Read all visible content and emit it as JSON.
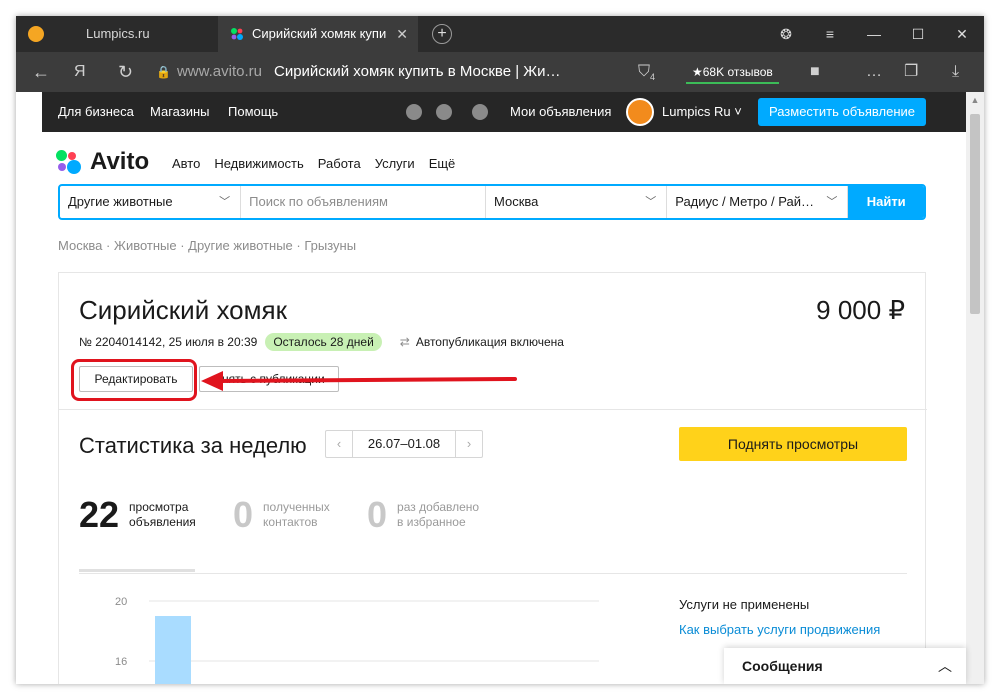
{
  "browser": {
    "tabs": [
      {
        "label": "Lumpics.ru"
      },
      {
        "label": "Сирийский хомяк купи"
      }
    ],
    "url_host": "www.avito.ru",
    "url_title": "Сирийский хомяк купить в Москве | Жи…",
    "protect_count": "4",
    "reviews": "★68K отзывов",
    "window_controls": {
      "menu": "≡",
      "minimize": "—",
      "maximize": "☐",
      "close": "✕"
    }
  },
  "topnav": {
    "business": "Для бизнеса",
    "shops": "Магазины",
    "help": "Помощь",
    "my_ads": "Мои объявления",
    "user": "Lumpics Ru",
    "post_button": "Разместить объявление"
  },
  "header": {
    "brand": "Avito",
    "categories": [
      "Авто",
      "Недвижимость",
      "Работа",
      "Услуги",
      "Ещё"
    ]
  },
  "search": {
    "category": "Другие животные",
    "placeholder": "Поиск по объявлениям",
    "city": "Москва",
    "radius": "Радиус / Метро / Рай…",
    "button": "Найти"
  },
  "breadcrumbs": "Москва · Животные · Другие животные · Грызуны",
  "ad": {
    "title": "Сирийский хомяк",
    "price": "9 000 ₽",
    "meta": "№ 2204014142, 25 июля в 20:39",
    "remaining": "Осталось 28 дней",
    "autopub": "Автопубликация включена",
    "edit_button": "Редактировать",
    "remove_button": "Снять с публикации"
  },
  "stats": {
    "title": "Статистика за неделю",
    "range": "26.07–01.08",
    "boost_button": "Поднять просмотры",
    "metrics": [
      {
        "value": "22",
        "label1": "просмотра",
        "label2": "объявления"
      },
      {
        "value": "0",
        "label1": "полученных",
        "label2": "контактов"
      },
      {
        "value": "0",
        "label1": "раз добавлено",
        "label2": "в избранное"
      }
    ],
    "services_title": "Услуги не применены",
    "services_link": "Как выбрать услуги продвижения"
  },
  "chart_data": {
    "type": "bar",
    "yticks": [
      "20",
      "16"
    ],
    "ylim": [
      0,
      20
    ],
    "values": [
      19
    ],
    "bar_color": "#a9dcff"
  },
  "messages": {
    "label": "Сообщения"
  },
  "colors": {
    "accent": "#00aaff",
    "highlight": "#e0141e",
    "boost": "#ffd21a",
    "badge": "#c8f0b4"
  }
}
